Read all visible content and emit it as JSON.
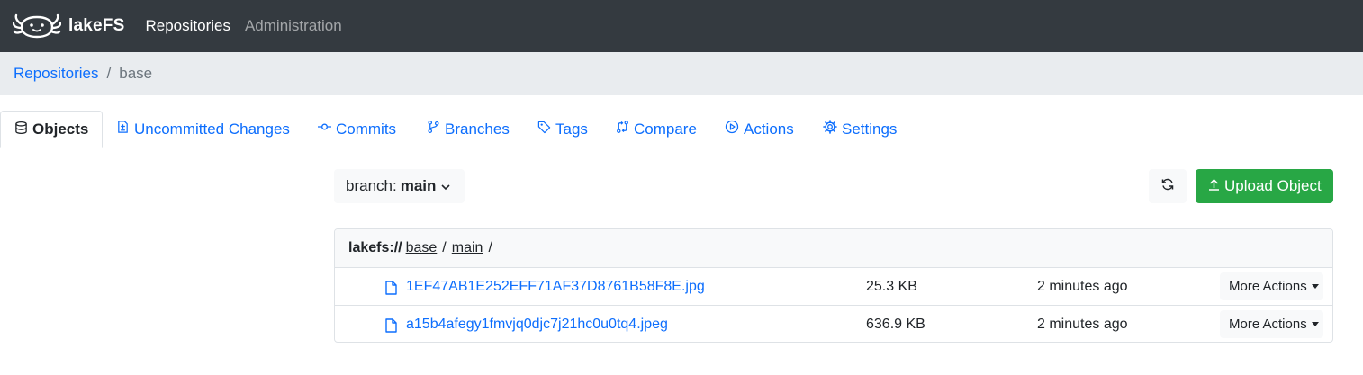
{
  "navbar": {
    "brand": "lakeFS",
    "links": [
      {
        "label": "Repositories",
        "active": true
      },
      {
        "label": "Administration",
        "active": false
      }
    ]
  },
  "breadcrumb": {
    "root": "Repositories",
    "separator": "/",
    "current": "base"
  },
  "tabs": [
    {
      "label": "Objects",
      "icon": "database-icon",
      "active": true
    },
    {
      "label": "Uncommitted Changes",
      "icon": "file-diff-icon",
      "active": false
    },
    {
      "label": "Commits",
      "icon": "git-commit-icon",
      "active": false
    },
    {
      "label": "Branches",
      "icon": "git-branch-icon",
      "active": false
    },
    {
      "label": "Tags",
      "icon": "tag-icon",
      "active": false
    },
    {
      "label": "Compare",
      "icon": "git-compare-icon",
      "active": false
    },
    {
      "label": "Actions",
      "icon": "play-icon",
      "active": false
    },
    {
      "label": "Settings",
      "icon": "gear-icon",
      "active": false
    }
  ],
  "toolbar": {
    "branch_prefix": "branch:",
    "branch_name": "main",
    "upload_label": "Upload Object"
  },
  "path": {
    "protocol": "lakefs://",
    "repo": "base",
    "separator": "/",
    "ref": "main",
    "trailing": "/"
  },
  "objects": [
    {
      "name": "1EF47AB1E252EFF71AF37D8761B58F8E.jpg",
      "size": "25.3 KB",
      "modified": "2 minutes ago",
      "action": "More Actions"
    },
    {
      "name": "a15b4afegy1fmvjq0djc7j21hc0u0tq4.jpeg",
      "size": "636.9 KB",
      "modified": "2 minutes ago",
      "action": "More Actions"
    }
  ],
  "colors": {
    "navbar": "#343a40",
    "link": "#0d6efd",
    "upload": "#28a745",
    "breadcrumb_bg": "#e9ecef"
  }
}
